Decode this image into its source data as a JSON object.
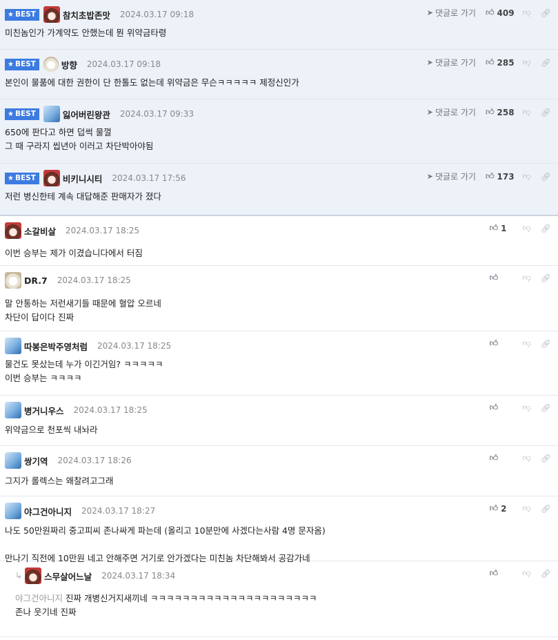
{
  "labels": {
    "best": "BEST",
    "reply": "댓글로 가기"
  },
  "comments": [
    {
      "badge": true,
      "avatar": "girl",
      "nick": "참치초밥존맛",
      "date": "2024.03.17 09:18",
      "likes": "409",
      "lines": [
        "미친놈인가 가계약도 안했는데 뭔 위약금타령"
      ]
    },
    {
      "badge": true,
      "avatar": "puppy",
      "nick": "방향",
      "date": "2024.03.17 09:18",
      "likes": "285",
      "lines": [
        "본인이 물품에 대한 권한이 단 한톨도 없는데 위약금은 무슨ㅋㅋㅋㅋㅋ 제정신인가"
      ]
    },
    {
      "badge": true,
      "avatar": "bird",
      "nick": "잃어버린왕관",
      "date": "2024.03.17 09:33",
      "likes": "258",
      "lines": [
        "650에 판다고 하면 덥썩 물껄",
        "그 때 구라지 씹년아 이러고 차단박아야됨"
      ]
    },
    {
      "badge": true,
      "avatar": "girl",
      "nick": "비키니시티",
      "date": "2024.03.17 17:56",
      "likes": "173",
      "lines": [
        "저런 병신한테 계속 대답해준 판매자가 졌다"
      ]
    },
    {
      "badge": false,
      "avatar": "girl",
      "nick": "소갈비살",
      "date": "2024.03.17 18:25",
      "likes": "1",
      "lines": [
        "이번 승부는 제가 이겼습니다에서 터짐"
      ]
    },
    {
      "badge": false,
      "avatar": "puppy",
      "nick": "DR.7",
      "date": "2024.03.17 18:25",
      "likes": "",
      "lines": [
        "말 안통하는 저런새기들 때문에 혈압 오르네",
        "차단이 답이다 진짜"
      ]
    },
    {
      "badge": false,
      "avatar": "bird",
      "nick": "따봉은박주영처럼",
      "date": "2024.03.17 18:25",
      "likes": "",
      "lines": [
        "물건도 못샀는데 누가 이긴거임? ㅋㅋㅋㅋㅋ",
        "이번 승부는 ㅋㅋㅋㅋ"
      ]
    },
    {
      "badge": false,
      "avatar": "bird",
      "nick": "병거니우스",
      "date": "2024.03.17 18:25",
      "likes": "",
      "lines": [
        "위약금으로 천포씩 내놔라"
      ]
    },
    {
      "badge": false,
      "avatar": "bird",
      "nick": "쌍기역",
      "date": "2024.03.17 18:26",
      "likes": "",
      "lines": [
        "그지가 롤렉스는 왜찰려고그래"
      ]
    },
    {
      "badge": false,
      "avatar": "bird",
      "nick": "야그건아니지",
      "date": "2024.03.17 18:27",
      "likes": "2",
      "lines": [
        "나도 50만원짜리 중고피씨 존나싸게 파는데 (올리고 10분만에 사겠다는사람 4명 문자옴)",
        "",
        "만나기 직전에 10만원 네고 안해주면 거기로 안가겠다는 미친놈 차단해봐서 공감가네"
      ]
    },
    {
      "badge": false,
      "avatar": "girl",
      "nick": "스무살어느날",
      "date": "2024.03.17 18:34",
      "likes": "",
      "mention": "야그건아니지",
      "lines": [
        "진짜 개병신거지새끼네 ㅋㅋㅋㅋㅋㅋㅋㅋㅋㅋㅋㅋㅋㅋㅋㅋㅋㅋㅋㅋㅋ",
        "존나 웃기네 진짜"
      ]
    }
  ]
}
